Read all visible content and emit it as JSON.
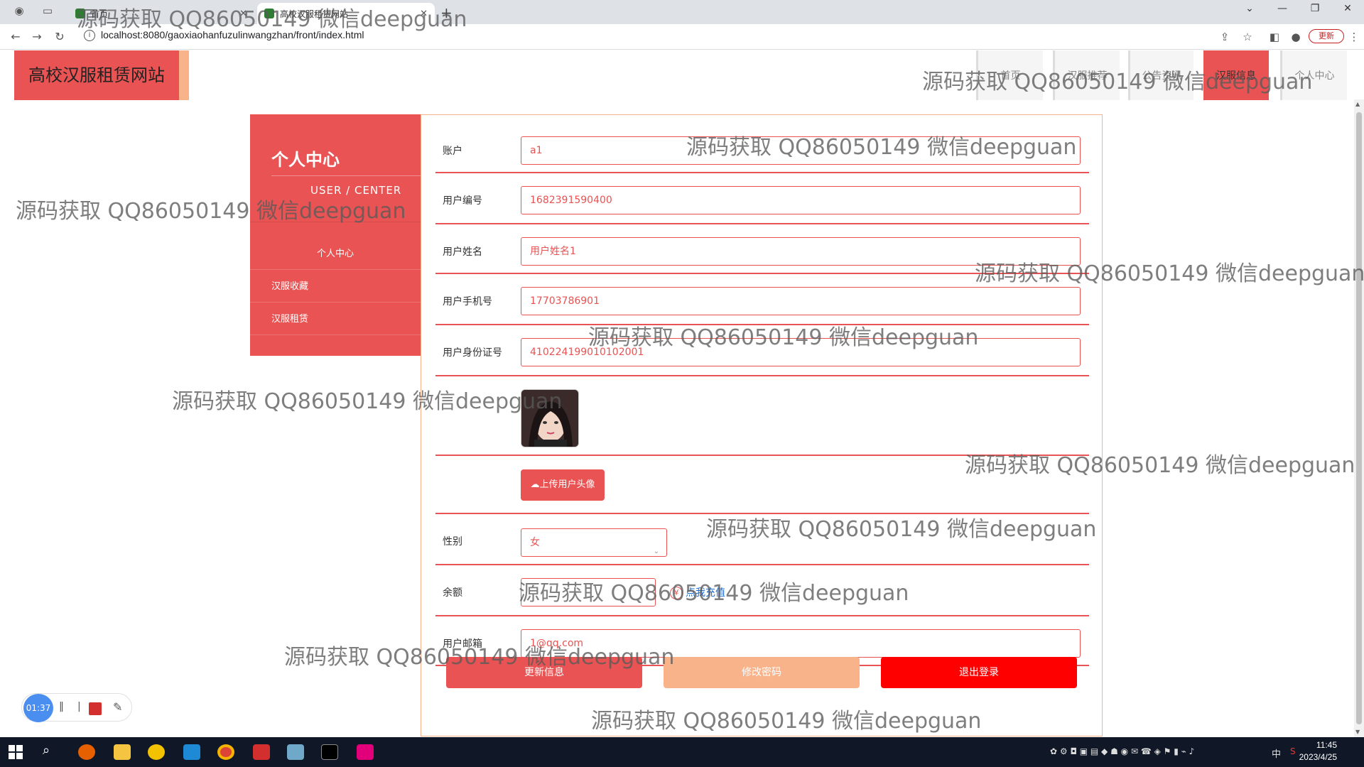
{
  "browser": {
    "tabs": [
      {
        "label": "首页"
      },
      {
        "label": "高校汉服租赁网站"
      }
    ],
    "url": "localhost:8080/gaoxiaohanfuzulinwangzhan/front/index.html",
    "update_label": "更新"
  },
  "site": {
    "logo": "高校汉服租赁网站",
    "nav": [
      {
        "label": "首页",
        "active": false
      },
      {
        "label": "汉服推荐",
        "active": false
      },
      {
        "label": "公告资讯",
        "active": false
      },
      {
        "label": "汉服信息",
        "active": true
      },
      {
        "label": "个人中心",
        "active": false
      }
    ]
  },
  "sidebar": {
    "title": "个人中心",
    "subtitle": "USER / CENTER",
    "items": [
      {
        "label": "个人中心"
      },
      {
        "label": "汉服收藏"
      },
      {
        "label": "汉服租赁"
      }
    ]
  },
  "form": {
    "account": {
      "label": "账户",
      "value": "a1"
    },
    "user_no": {
      "label": "用户编号",
      "value": "1682391590400"
    },
    "user_name": {
      "label": "用户姓名",
      "value": "用户姓名1"
    },
    "phone": {
      "label": "用户手机号",
      "value": "17703786901"
    },
    "id_card": {
      "label": "用户身份证号",
      "value": "410224199010102001"
    },
    "upload_label": "上传用户头像",
    "gender": {
      "label": "性别",
      "value": "女"
    },
    "balance": {
      "label": "余额",
      "value": "",
      "recharge_label": "点我充值"
    },
    "email": {
      "label": "用户邮箱",
      "value": "1@qq.com"
    }
  },
  "actions": {
    "update": "更新信息",
    "change_password": "修改密码",
    "logout": "退出登录"
  },
  "recorder": {
    "time": "01:37"
  },
  "clock": {
    "time": "11:45",
    "date": "2023/4/25"
  },
  "watermark": "源码获取 QQ86050149 微信deepguan",
  "colors": {
    "accent": "#e95353",
    "peach": "#f9b38a",
    "logout": "#ff0000",
    "link": "#1f6fd1"
  }
}
